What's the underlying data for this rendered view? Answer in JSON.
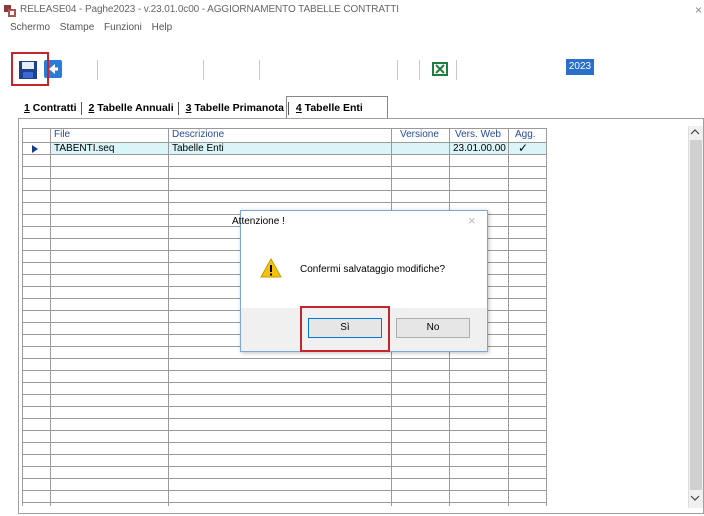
{
  "window": {
    "title": "RELEASE04 - Paghe2023 - v.23.01.0c00 - AGGIORNAMENTO TABELLE CONTRATTI",
    "close": "×"
  },
  "menu": {
    "items": [
      "Schermo",
      "Stampe",
      "Funzioni",
      "Help"
    ]
  },
  "toolbar": {
    "year": "2023",
    "icons": [
      "save-icon",
      "back-arrow-icon",
      "excel-icon"
    ]
  },
  "tabs": [
    {
      "key": "1",
      "label": " Contratti"
    },
    {
      "key": "2",
      "label": " Tabelle Annuali"
    },
    {
      "key": "3",
      "label": " Tabelle Primanota"
    },
    {
      "key": "4",
      "label": " Tabelle Enti"
    }
  ],
  "grid": {
    "columns": [
      "File",
      "Descrizione",
      "Versione",
      "Vers. Web",
      "Agg."
    ],
    "rows": [
      {
        "file": "TABENTI.seq",
        "descrizione": "Tabelle Enti",
        "versione": "",
        "vers_web": "23.01.00.00",
        "agg": "✓"
      }
    ]
  },
  "dialog": {
    "title": "Attenzione !",
    "message": "Confermi salvataggio modifiche?",
    "yes": "Sì",
    "no": "No"
  },
  "colors": {
    "highlight": "#c4262c",
    "row_selected": "#d9f5f7",
    "year_badge": "#2a6fcb"
  }
}
